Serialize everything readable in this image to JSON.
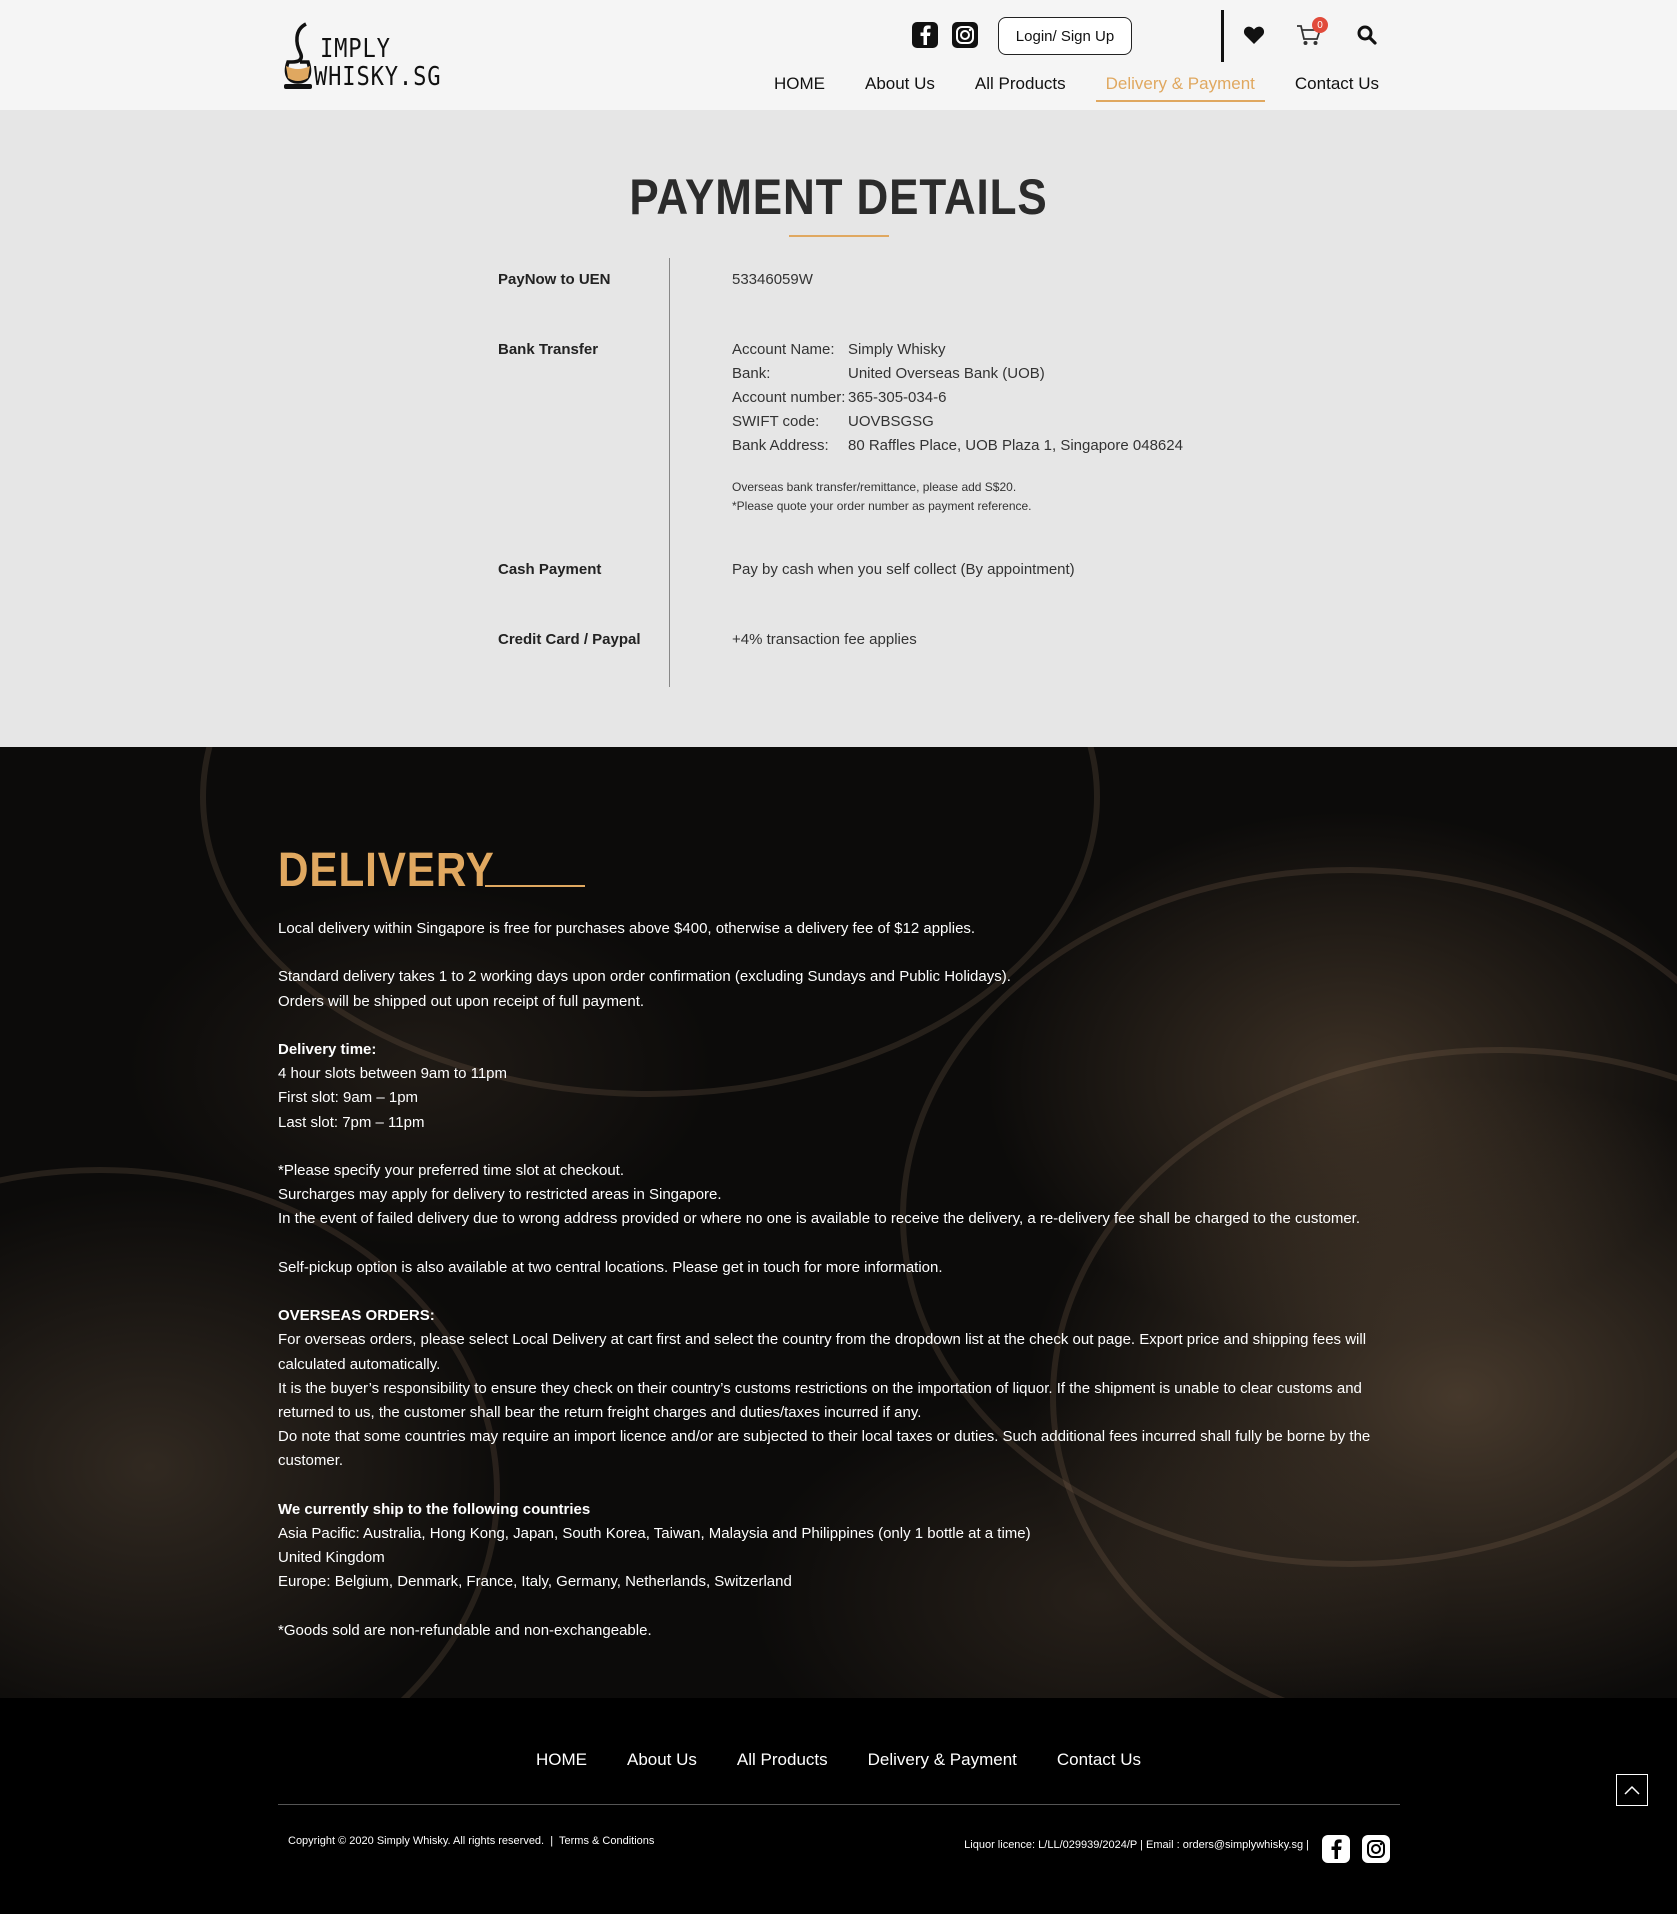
{
  "brand": {
    "line1": "IMPLY",
    "line2": "WHISKY.SG",
    "accent": "#e0a860"
  },
  "header": {
    "login_label": "Login/ Sign Up",
    "cart_count": "0",
    "nav": [
      "HOME",
      "About Us",
      "All Products",
      "Delivery & Payment",
      "Contact Us"
    ],
    "active_nav": "Delivery & Payment",
    "icons": [
      "facebook-icon",
      "instagram-icon",
      "heart-icon",
      "cart-icon",
      "search-icon"
    ]
  },
  "payment": {
    "title": "PAYMENT DETAILS",
    "paynow": {
      "label": "PayNow to UEN",
      "value": "53346059W"
    },
    "bank": {
      "label": "Bank Transfer",
      "rows": [
        {
          "k": "Account Name:",
          "v": "Simply Whisky"
        },
        {
          "k": "Bank:",
          "v": "United Overseas Bank (UOB)"
        },
        {
          "k": "Account number:",
          "v": "365-305-034-6"
        },
        {
          "k": "SWIFT code:",
          "v": "UOVBSGSG"
        },
        {
          "k": "Bank Address:",
          "v": "80 Raffles Place, UOB Plaza 1, Singapore 048624"
        }
      ],
      "note1": "Overseas bank transfer/remittance, please add S$20.",
      "note2": "*Please quote your order number as payment reference."
    },
    "cash": {
      "label": "Cash Payment",
      "value": "Pay by cash when you self collect (By appointment)"
    },
    "card": {
      "label": "Credit Card / Paypal",
      "value": "+4% transaction fee applies"
    }
  },
  "delivery": {
    "title": "DELIVERY",
    "p1": "Local delivery within Singapore is free for purchases above $400, otherwise a delivery fee of $12 applies.",
    "p2a": "Standard delivery takes 1 to 2 working days upon order confirmation (excluding Sundays and Public Holidays).",
    "p2b": "Orders will be shipped out upon receipt of full payment.",
    "time_heading": "Delivery time:",
    "time1": "4 hour slots between 9am to 11pm",
    "time2": "First slot: 9am – 1pm",
    "time3": "Last slot: 7pm – 11pm",
    "p4a": "*Please specify your preferred time slot at checkout.",
    "p4b": "Surcharges may apply for delivery to restricted areas in Singapore.",
    "p4c": "In the event of failed delivery due to wrong address provided or where no one is available to receive the delivery, a re-delivery fee shall be charged to the customer.",
    "p5": "Self-pickup option is also available at two central locations. Please get in touch for more information.",
    "overseas_heading": "OVERSEAS ORDERS:",
    "o1": "For overseas orders, please select Local Delivery at cart first and select the country from the dropdown list at the check out page. Export price and shipping fees will calculated automatically.",
    "o2": "It is the buyer’s responsibility to ensure they check on their country’s customs restrictions on the importation of liquor. If the shipment is unable to clear customs and returned to us, the customer shall bear the return freight charges and duties/taxes incurred if any.",
    "o3": "Do note that some countries may require an import licence and/or are subjected to their local taxes or duties. Such additional fees incurred shall fully be borne by the customer.",
    "ship_heading": "We currently ship to the following countries",
    "s1": "Asia Pacific: Australia, Hong Kong, Japan, South Korea, Taiwan, Malaysia and Philippines (only 1 bottle at a time)",
    "s2": "United Kingdom",
    "s3": "Europe: Belgium, Denmark, France, Italy, Germany, Netherlands, Switzerland",
    "p_final": "*Goods sold are non-refundable and non-exchangeable."
  },
  "footer": {
    "nav": [
      "HOME",
      "About Us",
      "All Products",
      "Delivery & Payment",
      "Contact Us"
    ],
    "copyright": "Copyright © 2020 Simply Whisky. All rights reserved.",
    "terms": "Terms & Conditions",
    "licence": "Liquor licence: L/LL/029939/2024/P |   Email : orders@simplywhisky.sg   |"
  }
}
